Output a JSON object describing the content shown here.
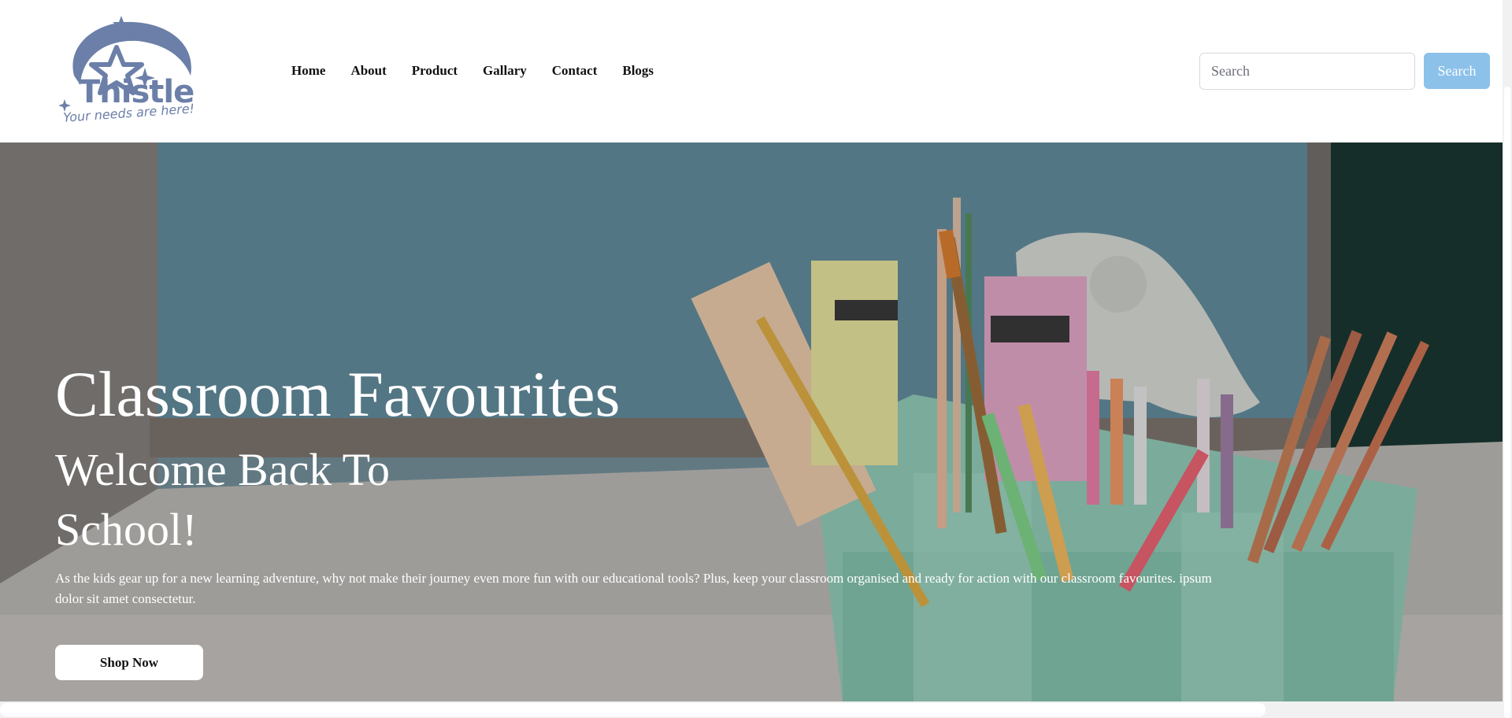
{
  "brand": {
    "name": "Thistle",
    "tagline": "Your needs are here!",
    "logo_icon": "star-logo-icon",
    "color": "#6b7fa8"
  },
  "nav": {
    "items": [
      {
        "label": "Home"
      },
      {
        "label": "About"
      },
      {
        "label": "Product"
      },
      {
        "label": "Gallary"
      },
      {
        "label": "Contact"
      },
      {
        "label": "Blogs"
      }
    ]
  },
  "search": {
    "placeholder": "Search",
    "value": "",
    "button_label": "Search",
    "button_color": "#8cc1ea"
  },
  "hero": {
    "heading": "Classroom Favourites",
    "subheading": "Welcome Back To School!",
    "description": "As the kids gear up for a new learning adventure, why not make their journey even more fun with our educational tools? Plus, keep your classroom organised and ready for action with our classroom favourites. ipsum dolor sit amet consectetur.",
    "cta_label": "Shop Now",
    "image": "classroom-art-supplies-caddy"
  }
}
